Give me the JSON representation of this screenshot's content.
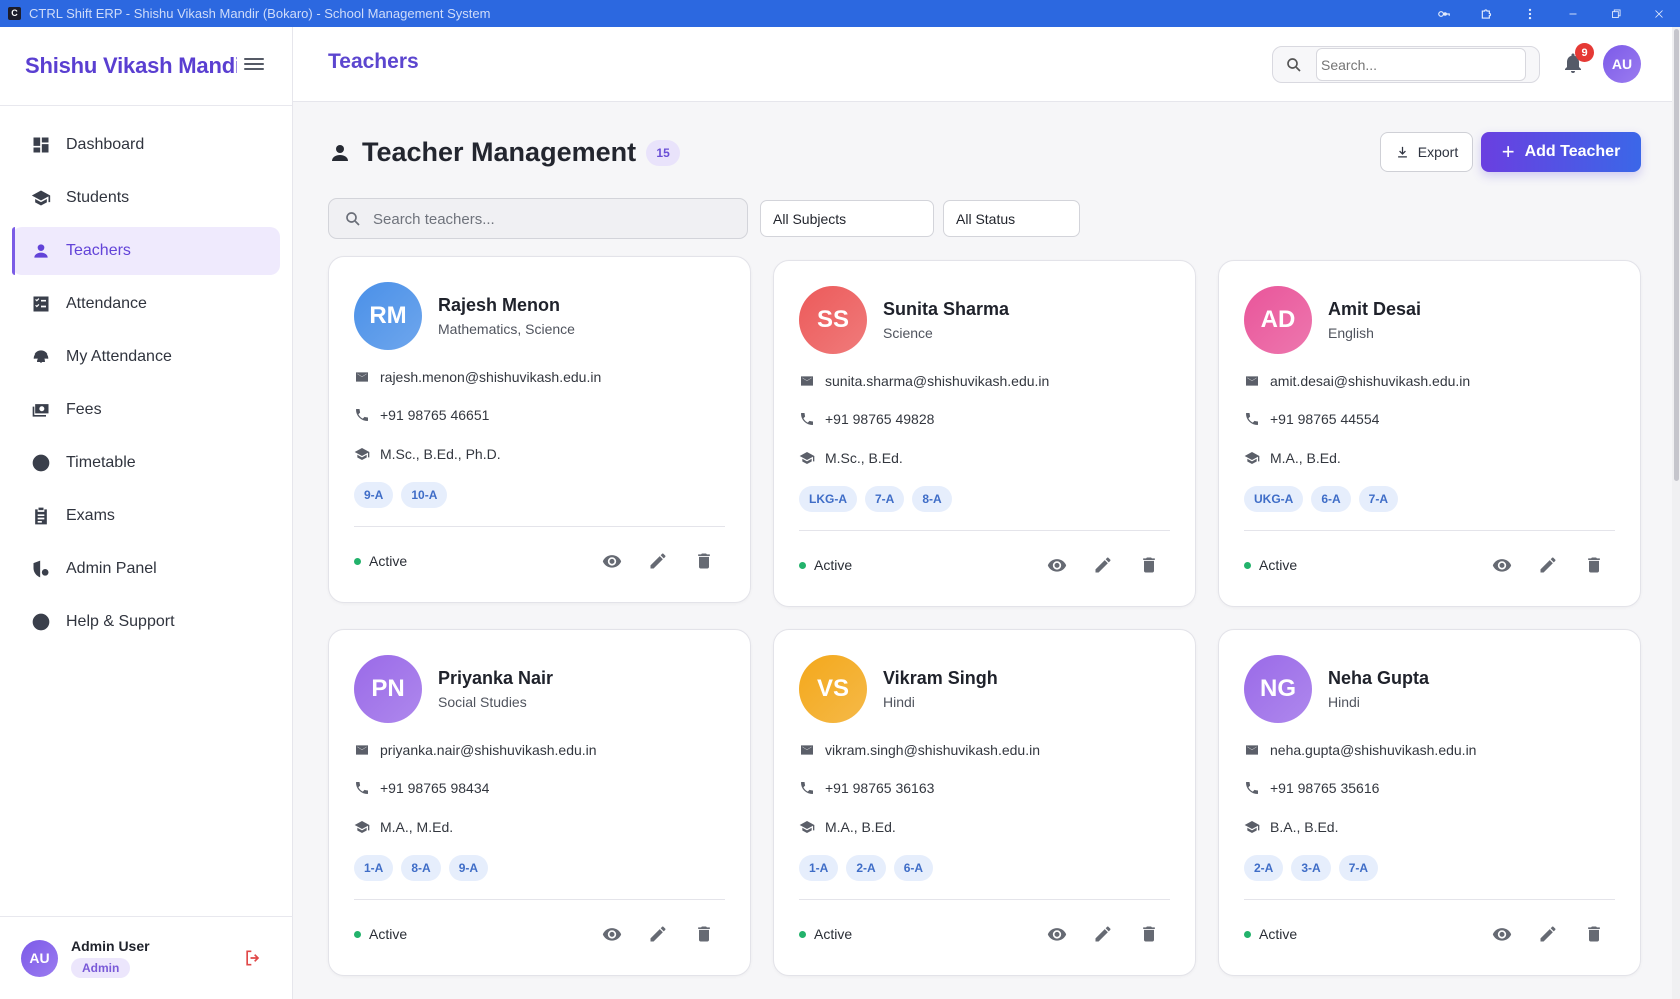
{
  "window": {
    "title": "CTRL Shift ERP - Shishu Vikash Mandir (Bokaro) - School Management System",
    "app_icon": "C"
  },
  "sidebar": {
    "brand": "Shishu Vikash Mandir",
    "items": [
      {
        "label": "Dashboard",
        "icon": "dashboard-icon"
      },
      {
        "label": "Students",
        "icon": "graduation-cap-icon"
      },
      {
        "label": "Teachers",
        "icon": "person-icon",
        "active": true
      },
      {
        "label": "Attendance",
        "icon": "checklist-icon"
      },
      {
        "label": "My Attendance",
        "icon": "fingerprint-icon"
      },
      {
        "label": "Fees",
        "icon": "money-icon"
      },
      {
        "label": "Timetable",
        "icon": "clock-icon"
      },
      {
        "label": "Exams",
        "icon": "clipboard-icon"
      },
      {
        "label": "Admin Panel",
        "icon": "admin-shield-icon"
      },
      {
        "label": "Help & Support",
        "icon": "lifebuoy-icon"
      }
    ],
    "user": {
      "initials": "AU",
      "name": "Admin User",
      "role": "Admin"
    }
  },
  "header": {
    "title": "Teachers",
    "search_placeholder": "Search...",
    "notifications": "9",
    "avatar": "AU"
  },
  "main": {
    "title": "Teacher Management",
    "count": "15",
    "export_label": "Export",
    "add_label": "Add Teacher",
    "search_placeholder": "Search teachers...",
    "subject_filter": "All Subjects",
    "status_filter": "All Status"
  },
  "teachers": [
    {
      "initials": "RM",
      "name": "Rajesh Menon",
      "subjects": "Mathematics, Science",
      "email": "rajesh.menon@shishuvikash.edu.in",
      "phone": "+91 98765 46651",
      "qualification": "M.Sc., B.Ed., Ph.D.",
      "classes": [
        "9-A",
        "10-A"
      ],
      "status": "Active",
      "color": "#4a90e8"
    },
    {
      "initials": "SS",
      "name": "Sunita Sharma",
      "subjects": "Science",
      "email": "sunita.sharma@shishuvikash.edu.in",
      "phone": "+91 98765 49828",
      "qualification": "M.Sc., B.Ed.",
      "classes": [
        "LKG-A",
        "7-A",
        "8-A"
      ],
      "status": "Active",
      "color": "#ec5a5a"
    },
    {
      "initials": "AD",
      "name": "Amit Desai",
      "subjects": "English",
      "email": "amit.desai@shishuvikash.edu.in",
      "phone": "+91 98765 44554",
      "qualification": "M.A., B.Ed.",
      "classes": [
        "UKG-A",
        "6-A",
        "7-A"
      ],
      "status": "Active",
      "color": "#e9559a"
    },
    {
      "initials": "PN",
      "name": "Priyanka Nair",
      "subjects": "Social Studies",
      "email": "priyanka.nair@shishuvikash.edu.in",
      "phone": "+91 98765 98434",
      "qualification": "M.A., M.Ed.",
      "classes": [
        "1-A",
        "8-A",
        "9-A"
      ],
      "status": "Active",
      "color": "#9a6ae8"
    },
    {
      "initials": "VS",
      "name": "Vikram Singh",
      "subjects": "Hindi",
      "email": "vikram.singh@shishuvikash.edu.in",
      "phone": "+91 98765 36163",
      "qualification": "M.A., B.Ed.",
      "classes": [
        "1-A",
        "2-A",
        "6-A"
      ],
      "status": "Active",
      "color": "#f3a81b"
    },
    {
      "initials": "NG",
      "name": "Neha Gupta",
      "subjects": "Hindi",
      "email": "neha.gupta@shishuvikash.edu.in",
      "phone": "+91 98765 35616",
      "qualification": "B.A., B.Ed.",
      "classes": [
        "2-A",
        "3-A",
        "7-A"
      ],
      "status": "Active",
      "color": "#9a6ae8"
    }
  ]
}
